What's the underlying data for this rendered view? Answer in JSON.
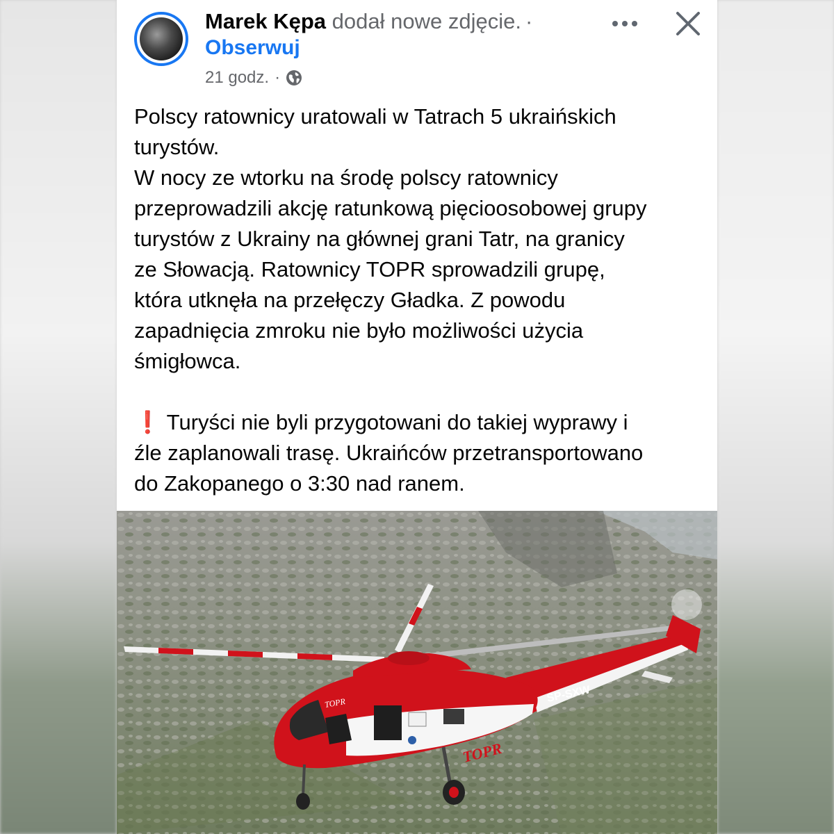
{
  "post": {
    "author": "Marek Kępa",
    "action": "dodał nowe zdjęcie.",
    "separator": "·",
    "follow_label": "Obserwuj",
    "time": "21 godz.",
    "meta_separator": "·",
    "text_lines": [
      "Polscy ratownicy uratowali w Tatrach 5 ukraińskich",
      "turystów.",
      "W nocy ze wtorku na środę polscy ratownicy",
      "przeprowadzili akcję ratunkową pięcioosobowej grupy",
      "turystów z Ukrainy na głównej grani Tatr, na granicy",
      "ze Słowacją. Ratownicy TOPR sprowadzili grupę,",
      "która utknęła na przełęczy Gładka. Z powodu",
      "zapadnięcia zmroku nie było możliwości użycia",
      "śmigłowca."
    ],
    "warning_emoji": "❗",
    "warning_lines": [
      "Turyści nie byli przygotowani do takiej wyprawy i",
      "źle zaplanowali trasę. Ukraińców przetransportowano",
      "do Zakopanego o 3:30 nad ranem."
    ],
    "photo": {
      "helicopter_text": "TOPR",
      "registration": "SP-SXW"
    }
  },
  "icons": {
    "more": "more-options-icon",
    "close": "close-icon",
    "privacy": "globe-icon"
  },
  "colors": {
    "link_blue": "#1877f2",
    "secondary_gray": "#65676b",
    "heli_red": "#d0121b"
  }
}
